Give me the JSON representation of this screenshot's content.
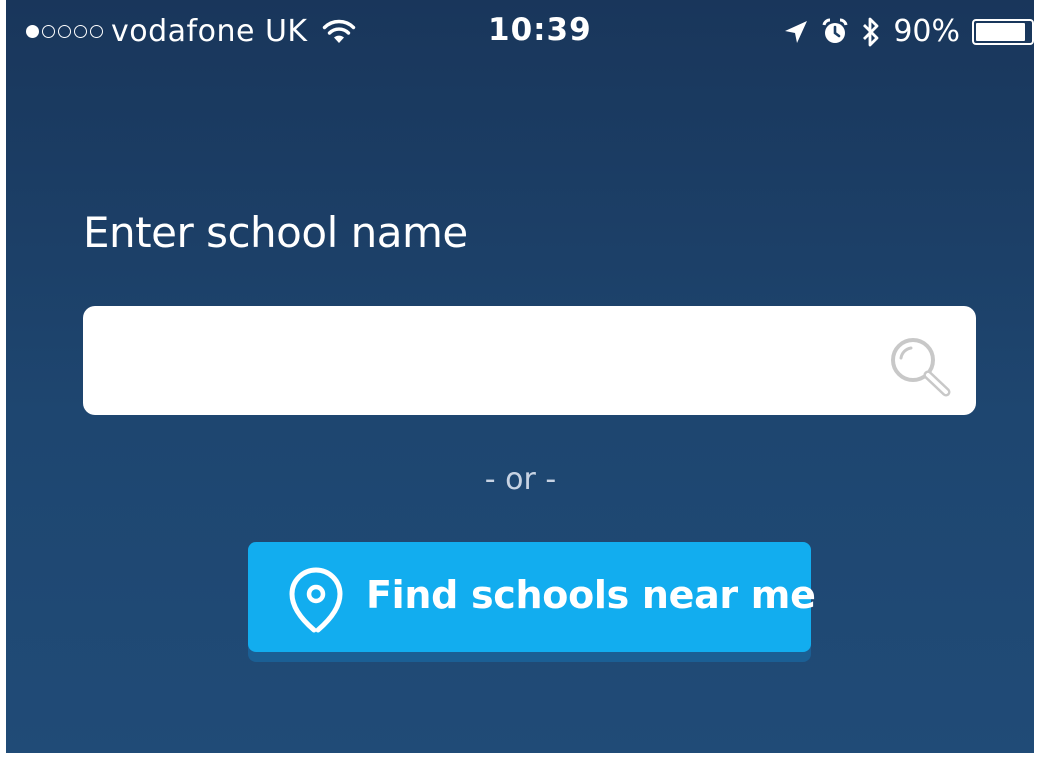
{
  "status_bar": {
    "signal_dots_filled": 1,
    "signal_dots_total": 5,
    "carrier": "vodafone UK",
    "time": "10:39",
    "battery_percent": "90%",
    "battery_level": 0.9,
    "icons": [
      "wifi-icon",
      "location-arrow-icon",
      "alarm-icon",
      "bluetooth-icon",
      "battery-icon"
    ]
  },
  "search": {
    "label": "Enter school name",
    "value": "",
    "placeholder": "",
    "icon": "search-icon"
  },
  "divider": {
    "text": "- or -"
  },
  "find_button": {
    "label": "Find schools near me",
    "icon": "location-pin-icon"
  },
  "colors": {
    "background_top": "#19365b",
    "background_bottom": "#204b77",
    "button": "#12adef",
    "button_shadow": "#1b5f94",
    "divider_text": "#c7d3e3",
    "search_icon": "#c8c8c8"
  }
}
